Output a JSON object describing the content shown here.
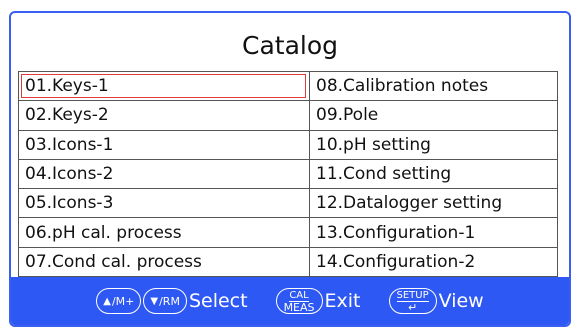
{
  "title": "Catalog",
  "items": [
    {
      "left": "01.Keys-1",
      "right": "08.Calibration notes"
    },
    {
      "left": "02.Keys-2",
      "right": "09.Pole"
    },
    {
      "left": "03.Icons-1",
      "right": "10.pH setting"
    },
    {
      "left": "04.Icons-2",
      "right": "11.Cond setting"
    },
    {
      "left": "05.Icons-3",
      "right": "12.Datalogger setting"
    },
    {
      "left": "06.pH cal. process",
      "right": "13.Configuration-1"
    },
    {
      "left": "07.Cond cal. process",
      "right": "14.Configuration-2"
    }
  ],
  "selected": "01.Keys-1",
  "footer": {
    "up_key": "/M+",
    "down_key": "/RM",
    "select_label": "Select",
    "cal_top": "CAL",
    "cal_bottom": "MEAS",
    "exit_label": "Exit",
    "setup_top": "SETUP",
    "setup_bottom": "↵",
    "view_label": "View"
  },
  "colors": {
    "frame": "#3a5ef0",
    "footer_bg": "#2e58f3",
    "selection": "#e03a3a"
  }
}
